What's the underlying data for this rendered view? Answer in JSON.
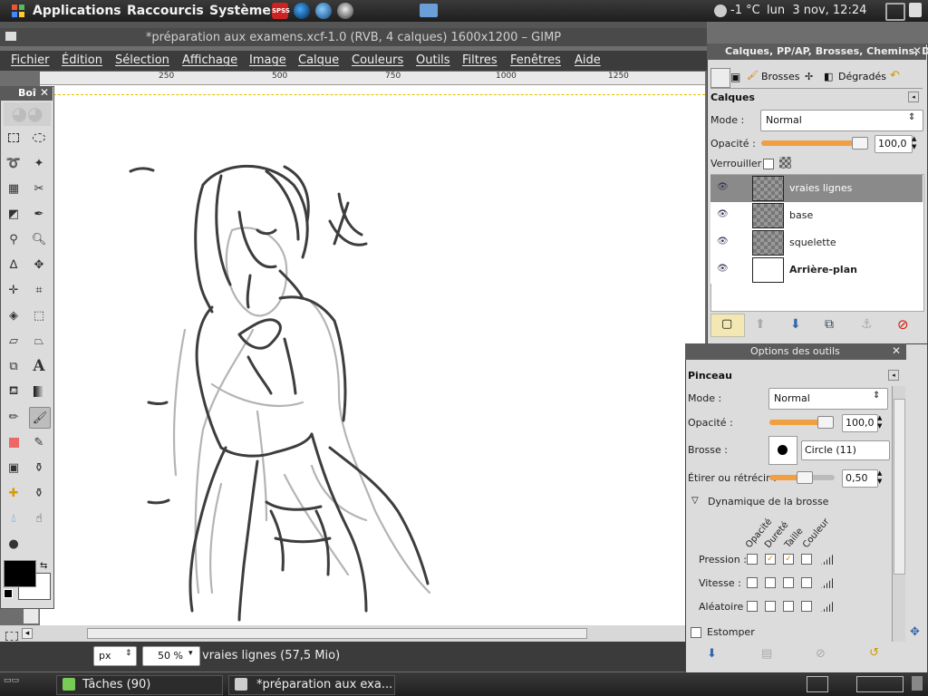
{
  "system_panel": {
    "menus": [
      "Applications",
      "Raccourcis",
      "Système"
    ],
    "weather": "-1 °C",
    "datetime": "lun  3 nov, 12:24"
  },
  "window": {
    "title": "*préparation aux examens.xcf-1.0 (RVB, 4 calques) 1600x1200 – GIMP"
  },
  "menubar": [
    "Fichier",
    "Édition",
    "Sélection",
    "Affichage",
    "Image",
    "Calque",
    "Couleurs",
    "Outils",
    "Filtres",
    "Fenêtres",
    "Aide"
  ],
  "ruler": {
    "marks": [
      "250",
      "500",
      "750",
      "1000",
      "1250"
    ]
  },
  "toolbox": {
    "title": "Boî"
  },
  "layers_dock": {
    "header": "Calques, PP/AP, Brosses, Chemins, D",
    "tabs": [
      "Brosses",
      "Dégradés"
    ],
    "panel_title": "Calques",
    "mode_label": "Mode :",
    "mode_value": "Normal",
    "opacity_label": "Opacité :",
    "opacity_value": "100,0",
    "opacity_level": 1.0,
    "lock_label": "Verrouiller :",
    "layers": [
      {
        "name": "vraies lignes",
        "selected": true
      },
      {
        "name": "base",
        "selected": false
      },
      {
        "name": "squelette",
        "selected": false
      },
      {
        "name": "Arrière-plan",
        "selected": false
      }
    ]
  },
  "tool_options": {
    "header": "Options des outils",
    "tool_name": "Pinceau",
    "mode_label": "Mode :",
    "mode_value": "Normal",
    "opacity_label": "Opacité :",
    "opacity_value": "100,0",
    "opacity_level": 1.0,
    "brush_label": "Brosse :",
    "brush_value": "Circle (11)",
    "scale_label": "Étirer ou rétrécir :",
    "scale_value": "0,50",
    "scale_level": 0.55,
    "dynamics_label": "Dynamique de la brosse",
    "dynamics_columns": [
      "Opacité",
      "Dureté",
      "Taille",
      "Couleur"
    ],
    "dynamics_rows": [
      {
        "label": "Pression :",
        "checks": [
          false,
          true,
          true,
          false
        ]
      },
      {
        "label": "Vitesse :",
        "checks": [
          false,
          false,
          false,
          false
        ]
      },
      {
        "label": "Aléatoire :",
        "checks": [
          false,
          false,
          false,
          false
        ]
      }
    ],
    "fade_label": "Estomper"
  },
  "statusbar": {
    "unit": "px",
    "zoom": "50 %",
    "info": "vraies lignes (57,5 Mio)"
  },
  "taskbar": {
    "items": [
      "Tâches (90)",
      "*préparation aux exa..."
    ]
  }
}
